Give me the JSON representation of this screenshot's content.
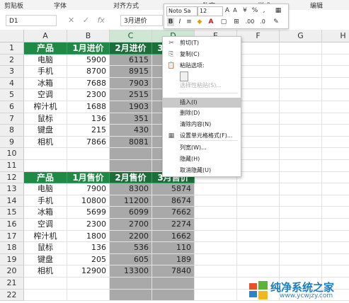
{
  "ribbon": {
    "groups": [
      "剪贴板",
      "字体",
      "对齐方式",
      "数字",
      "样式",
      "编辑"
    ]
  },
  "formula_bar": {
    "name_box": "D1",
    "formula": "3月进价",
    "fx": "fx"
  },
  "columns": [
    "A",
    "B",
    "C",
    "D",
    "E",
    "F",
    "G",
    "H"
  ],
  "rows": [
    "1",
    "2",
    "3",
    "4",
    "5",
    "6",
    "7",
    "8",
    "9",
    "10",
    "11",
    "12",
    "13",
    "14",
    "15",
    "16",
    "17",
    "18",
    "19",
    "20",
    "21",
    "22"
  ],
  "table1": {
    "headers": [
      "产品",
      "1月进价",
      "2月进价",
      "3月进价"
    ],
    "rows": [
      [
        "电脑",
        "5900",
        "6115",
        ""
      ],
      [
        "手机",
        "8700",
        "8915",
        ""
      ],
      [
        "冰箱",
        "7688",
        "7903",
        ""
      ],
      [
        "空调",
        "2300",
        "2515",
        ""
      ],
      [
        "榨汁机",
        "1688",
        "1903",
        ""
      ],
      [
        "鼠标",
        "136",
        "351",
        ""
      ],
      [
        "键盘",
        "215",
        "430",
        ""
      ],
      [
        "相机",
        "7866",
        "8081",
        ""
      ]
    ]
  },
  "table2": {
    "headers": [
      "产品",
      "1月售价",
      "2月售价",
      "3月售价"
    ],
    "rows": [
      [
        "电脑",
        "7900",
        "8300",
        "5874"
      ],
      [
        "手机",
        "10800",
        "11200",
        "8674"
      ],
      [
        "冰箱",
        "5699",
        "6099",
        "7662"
      ],
      [
        "空调",
        "2300",
        "2700",
        "2274"
      ],
      [
        "榨汁机",
        "1800",
        "2200",
        "1662"
      ],
      [
        "鼠标",
        "136",
        "536",
        "110"
      ],
      [
        "键盘",
        "205",
        "605",
        "189"
      ],
      [
        "相机",
        "12900",
        "13300",
        "7840"
      ]
    ]
  },
  "mini_toolbar": {
    "font": "Noto Sa",
    "size": "12",
    "bold": "B",
    "italic": "I",
    "percent": "%",
    "comma": ","
  },
  "context_menu": {
    "items": [
      {
        "label": "剪切(T)",
        "icon": "✂"
      },
      {
        "label": "复制(C)",
        "icon": "⎘"
      },
      {
        "label": "粘贴选项:",
        "icon": "📋"
      },
      {
        "label": "选择性粘贴(S)...",
        "icon": ""
      },
      {
        "label": "插入(I)",
        "icon": ""
      },
      {
        "label": "删除(D)",
        "icon": ""
      },
      {
        "label": "清除内容(N)",
        "icon": ""
      },
      {
        "label": "设置单元格格式(F)...",
        "icon": "▦"
      },
      {
        "label": "列宽(W)...",
        "icon": ""
      },
      {
        "label": "隐藏(H)",
        "icon": ""
      },
      {
        "label": "取消隐藏(U)",
        "icon": ""
      }
    ]
  },
  "watermark": {
    "title": "纯净系统之家",
    "url": "www.ycwjzy.com"
  },
  "colors": {
    "header_green": "#1e8a45",
    "selection_gray": "#a9a9a9",
    "watermark_blue": "#1a7fc1"
  }
}
